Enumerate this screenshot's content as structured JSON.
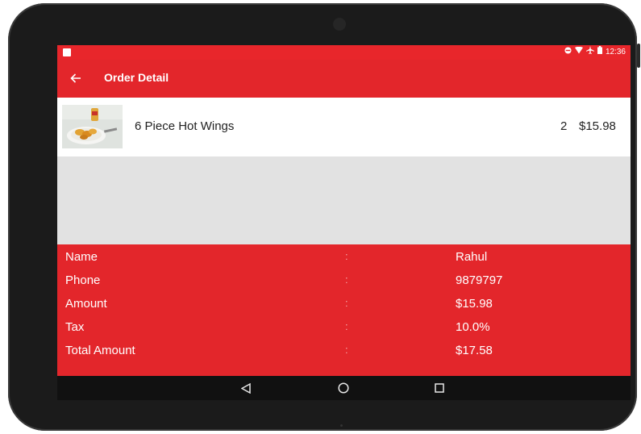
{
  "status": {
    "time": "12:36"
  },
  "toolbar": {
    "back_icon": "arrow-left-icon",
    "title": "Order Detail"
  },
  "order_items": [
    {
      "name": "6 Piece Hot Wings",
      "quantity": "2",
      "price": "$15.98"
    }
  ],
  "details": [
    {
      "label": "Name",
      "separator": ":",
      "value": "Rahul"
    },
    {
      "label": "Phone",
      "separator": ":",
      "value": "9879797"
    },
    {
      "label": "Amount",
      "separator": ":",
      "value": "$15.98"
    },
    {
      "label": "Tax",
      "separator": ":",
      "value": "10.0%"
    },
    {
      "label": "Total Amount",
      "separator": ":",
      "value": "$17.58"
    }
  ],
  "nav": {
    "back": "triangle-back-icon",
    "home": "circle-home-icon",
    "recents": "square-recents-icon"
  },
  "colors": {
    "accent": "#e3262b",
    "list_bg": "#e2e2e2",
    "nav_bg": "#111111"
  }
}
